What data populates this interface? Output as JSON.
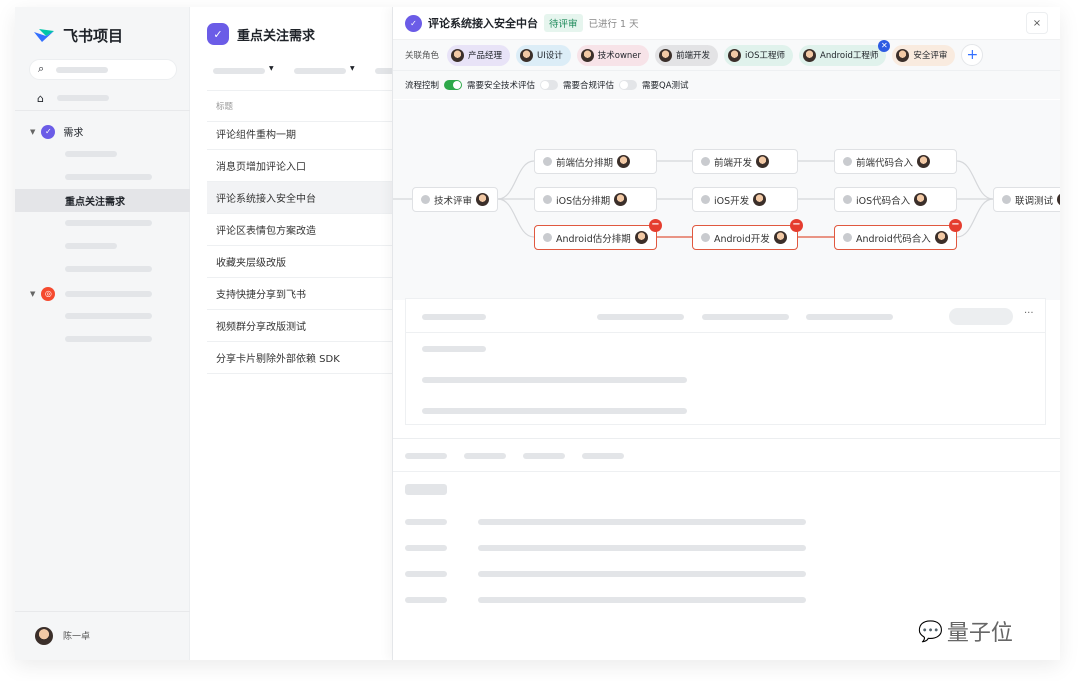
{
  "app": {
    "name": "飞书项目"
  },
  "sidebar": {
    "section_label": "需求",
    "selected_item": "重点关注需求",
    "user_name": "陈一卓"
  },
  "list": {
    "title": "重点关注需求",
    "column_header": "标题",
    "rows": [
      "评论组件重构一期",
      "消息页增加评论入口",
      "评论系统接入安全中台",
      "评论区表情包方案改造",
      "收藏夹层级改版",
      "支持快捷分享到飞书",
      "视频群分享改版测试",
      "分享卡片剔除外部依赖 SDK"
    ]
  },
  "detail": {
    "title": "评论系统接入安全中台",
    "status": "待评审",
    "elapsed": "已进行 1 天",
    "close": "×",
    "roles_label": "关联角色",
    "roles": [
      {
        "label": "产品经理",
        "color": "#e8e3f7"
      },
      {
        "label": "UI设计",
        "color": "#dcedf7"
      },
      {
        "label": "技术owner",
        "color": "#f7e3e8"
      },
      {
        "label": "前端开发",
        "color": "#e3e3e5"
      },
      {
        "label": "iOS工程师",
        "color": "#e0f2ec"
      },
      {
        "label": "Android工程师",
        "color": "#e0f2ec"
      },
      {
        "label": "安全评审",
        "color": "#f9ebdf"
      }
    ],
    "add": "+",
    "flow_label": "流程控制",
    "toggles": [
      {
        "label": "需要安全技术评估",
        "on": true
      },
      {
        "label": "需要合规评估",
        "on": false
      },
      {
        "label": "需要QA测试",
        "on": false
      }
    ],
    "nodes": {
      "tech_review": "技术评审",
      "fe_est": "前端估分排期",
      "fe_dev": "前端开发",
      "fe_merge": "前端代码合入",
      "ios_est": "iOS估分排期",
      "ios_dev": "iOS开发",
      "ios_merge": "iOS代码合入",
      "and_est": "Android估分排期",
      "and_dev": "Android开发",
      "and_merge": "Android代码合入",
      "joint_test": "联调测试"
    }
  },
  "watermark": "量子位",
  "colors": {
    "accent": "#6b5ce7",
    "green": "#2ea84a",
    "red": "#e53d2f"
  }
}
